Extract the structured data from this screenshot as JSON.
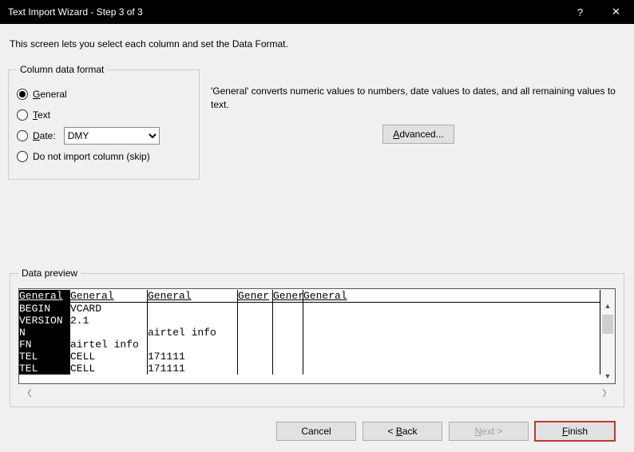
{
  "window": {
    "title": "Text Import Wizard - Step 3 of 3",
    "help": "?",
    "close": "✕"
  },
  "intro": "This screen lets you select each column and set the Data Format.",
  "format": {
    "legend": "Column data format",
    "general": "General",
    "text": "Text",
    "date": "Date:",
    "date_value": "DMY",
    "skip": "Do not import column (skip)"
  },
  "desc": "'General' converts numeric values to numbers, date values to dates, and all remaining values to text.",
  "advanced": "Advanced...",
  "preview": {
    "legend": "Data preview",
    "headers": [
      "General",
      "General",
      "General",
      "Gener",
      "Gener",
      "General"
    ],
    "rows": [
      [
        "BEGIN",
        "VCARD",
        "",
        "",
        "",
        ""
      ],
      [
        "VERSION",
        "2.1",
        "",
        "",
        "",
        ""
      ],
      [
        "N",
        "",
        "airtel info",
        "",
        "",
        ""
      ],
      [
        "FN",
        "airtel info",
        "",
        "",
        "",
        ""
      ],
      [
        "TEL",
        "CELL",
        "171111",
        "",
        "",
        ""
      ],
      [
        "TEL",
        "CELL",
        "171111",
        "",
        "",
        ""
      ]
    ]
  },
  "buttons": {
    "cancel": "Cancel",
    "back": "Back",
    "next": "Next",
    "finish": "Finish"
  }
}
